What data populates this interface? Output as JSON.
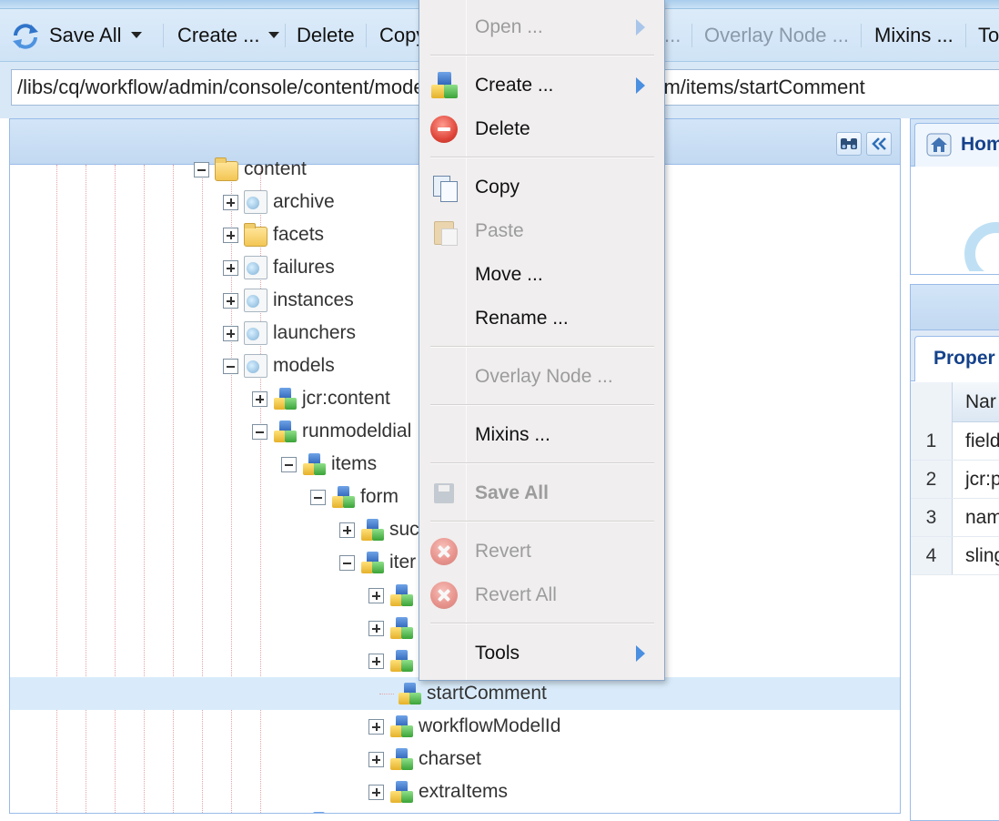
{
  "toolbar": {
    "save_all": "Save All",
    "create": "Create ...",
    "delete": "Delete",
    "copy": "Copy",
    "hidden_fragment": "...",
    "overlay_node": "Overlay Node ...",
    "mixins": "Mixins ...",
    "tools": "To"
  },
  "address": {
    "path": "/libs/cq/workflow/admin/console/content/models/runmodeldialog/items/form/items/startComment"
  },
  "tree": {
    "nodes": [
      {
        "label": "content",
        "icon": "folder-icon",
        "state": "expanded"
      },
      {
        "label": "archive",
        "icon": "page-icon",
        "state": "collapsed"
      },
      {
        "label": "facets",
        "icon": "folder-icon",
        "state": "collapsed"
      },
      {
        "label": "failures",
        "icon": "page-icon",
        "state": "collapsed"
      },
      {
        "label": "instances",
        "icon": "page-icon",
        "state": "collapsed"
      },
      {
        "label": "launchers",
        "icon": "page-icon",
        "state": "collapsed"
      },
      {
        "label": "models",
        "icon": "page-icon",
        "state": "expanded"
      },
      {
        "label": "jcr:content",
        "icon": "node-icon",
        "state": "collapsed"
      },
      {
        "label": "runmodeldial",
        "icon": "node-icon",
        "state": "expanded"
      },
      {
        "label": "items",
        "icon": "node-icon",
        "state": "expanded"
      },
      {
        "label": "form",
        "icon": "node-icon",
        "state": "expanded"
      },
      {
        "label": "suc",
        "icon": "node-icon",
        "state": "collapsed"
      },
      {
        "label": "iter",
        "icon": "node-icon",
        "state": "expanded"
      },
      {
        "label": "",
        "icon": "node-icon",
        "state": "collapsed"
      },
      {
        "label": "",
        "icon": "node-icon",
        "state": "collapsed"
      },
      {
        "label": "",
        "icon": "node-icon",
        "state": "collapsed"
      },
      {
        "label": "startComment",
        "icon": "node-icon",
        "state": "leaf-selected"
      },
      {
        "label": "workflowModelId",
        "icon": "node-icon",
        "state": "collapsed"
      },
      {
        "label": "charset",
        "icon": "node-icon",
        "state": "collapsed"
      },
      {
        "label": "extraItems",
        "icon": "node-icon",
        "state": "collapsed"
      }
    ]
  },
  "context_menu": {
    "open": "Open ...",
    "create": "Create ...",
    "delete": "Delete",
    "copy": "Copy",
    "paste": "Paste",
    "move": "Move ...",
    "rename": "Rename ...",
    "overlay_node": "Overlay Node ...",
    "mixins": "Mixins ...",
    "save_all": "Save All",
    "revert": "Revert",
    "revert_all": "Revert All",
    "tools": "Tools"
  },
  "right_panel": {
    "home_tab": "Hom",
    "properties_tab": "Proper",
    "grid_header_name": "Nar",
    "rows": [
      {
        "num": "1",
        "name": "field"
      },
      {
        "num": "2",
        "name": "jcr:p"
      },
      {
        "num": "3",
        "name": "nam"
      },
      {
        "num": "4",
        "name": "sling"
      }
    ]
  },
  "colors": {
    "toolbar_bg": "#d6e7f8",
    "panel_border": "#99bbe8",
    "selected_row": "#d9ebfa",
    "menu_bg": "#f0eeee",
    "accent_blue": "#15428b"
  }
}
